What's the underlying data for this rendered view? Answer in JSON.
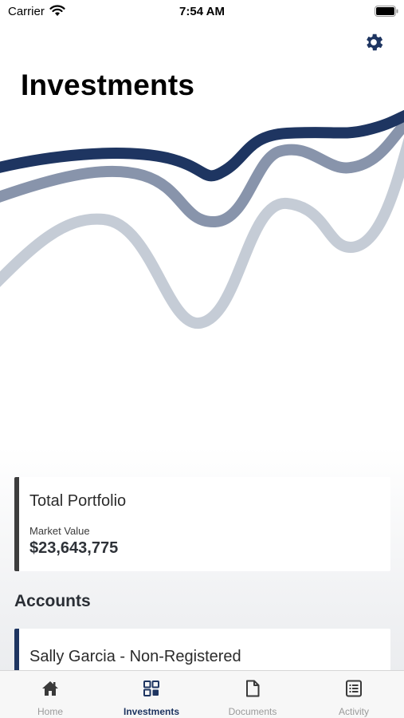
{
  "status_bar": {
    "carrier": "Carrier",
    "time": "7:54 AM"
  },
  "header": {
    "title": "Investments",
    "settings_icon": "gear-icon"
  },
  "colors": {
    "accent": "#1e3561",
    "line_mid": "#8894ab",
    "line_light": "#c5ccd6",
    "card_border": "#3d3d3d"
  },
  "portfolio": {
    "title": "Total Portfolio",
    "market_value_label": "Market Value",
    "market_value": "$23,643,775"
  },
  "accounts": {
    "heading": "Accounts",
    "items": [
      {
        "name": "Sally Garcia - Non-Registered"
      }
    ]
  },
  "tabs": [
    {
      "label": "Home",
      "icon": "home-icon",
      "active": false
    },
    {
      "label": "Investments",
      "icon": "grid-icon",
      "active": true
    },
    {
      "label": "Documents",
      "icon": "document-icon",
      "active": false
    },
    {
      "label": "Activity",
      "icon": "list-icon",
      "active": false
    }
  ]
}
